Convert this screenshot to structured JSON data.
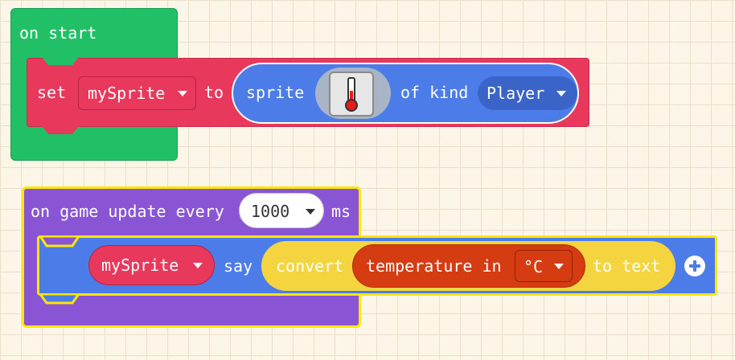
{
  "on_start": {
    "label": "on start"
  },
  "set_block": {
    "set_label": "set",
    "variable": "mySprite",
    "to_label": "to"
  },
  "sprite_block": {
    "sprite_label": "sprite",
    "image_icon": "thermometer-icon",
    "of_kind_label": "of kind",
    "kind": "Player"
  },
  "game_update": {
    "label": "on game update every",
    "interval": "1000",
    "unit": "ms"
  },
  "say_block": {
    "variable": "mySprite",
    "say_label": "say",
    "convert_label": "convert",
    "temperature_label": "temperature in",
    "temperature_unit": "°C",
    "to_text_label": "to text"
  },
  "colors": {
    "event_green": "#22c066",
    "variable_red": "#e8395c",
    "sprite_blue": "#4c7ce8",
    "loop_purple": "#8a55d4",
    "math_yellow": "#f4d540",
    "sensor_orange": "#d63c12",
    "highlight_yellow": "#ffe600"
  }
}
